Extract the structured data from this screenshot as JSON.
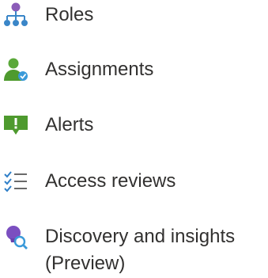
{
  "nav": {
    "items": [
      {
        "id": "roles",
        "label": "Roles",
        "icon": "roles-hierarchy-icon"
      },
      {
        "id": "assignments",
        "label": "Assignments",
        "icon": "user-assignment-icon"
      },
      {
        "id": "alerts",
        "label": "Alerts",
        "icon": "alert-icon"
      },
      {
        "id": "access-reviews",
        "label": "Access reviews",
        "icon": "checklist-icon"
      },
      {
        "id": "discovery",
        "label": "Discovery and insights",
        "label_line2": "(Preview)",
        "icon": "discovery-bulb-icon"
      }
    ]
  },
  "colors": {
    "text": "#323130",
    "roles_purple": "#8b5cb8",
    "roles_blue": "#3a86c8",
    "assignments_green": "#5aa839",
    "assignments_blue": "#3a9ad9",
    "alerts_green": "#4e9a2e",
    "checklist_blue": "#2f7fc8",
    "discovery_purple": "#7b4fc0",
    "discovery_blue": "#3a9ad9"
  }
}
